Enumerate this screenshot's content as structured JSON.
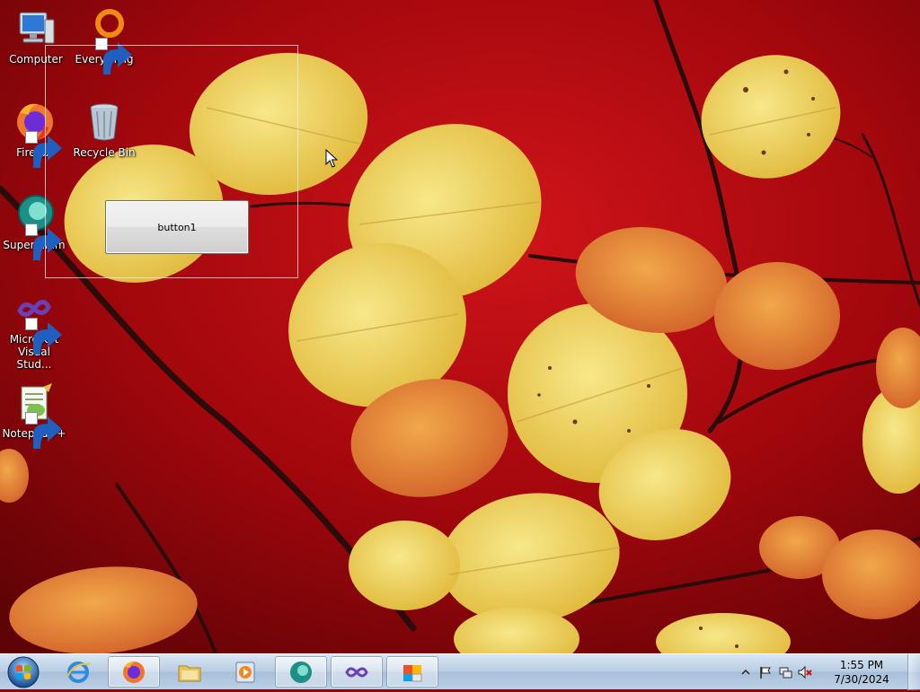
{
  "desktop": {
    "icons": [
      {
        "label": "Computer",
        "icon": "computer-icon"
      },
      {
        "label": "Everything",
        "icon": "everything-icon"
      },
      {
        "label": "Firefox",
        "icon": "firefox-icon"
      },
      {
        "label": "Recycle Bin",
        "icon": "recycle-bin-icon"
      },
      {
        "label": "Supermium",
        "icon": "supermium-icon"
      },
      {
        "label": "Microsoft Visual Stud...",
        "icon": "visual-studio-icon"
      },
      {
        "label": "Notepad++",
        "icon": "notepad-plus-plus-icon"
      }
    ]
  },
  "form": {
    "button_label": "button1"
  },
  "taskbar": {
    "start": "start-orb-icon",
    "pinned": [
      {
        "icon": "internet-explorer-icon",
        "active": false
      },
      {
        "icon": "firefox-icon",
        "active": true
      },
      {
        "icon": "file-explorer-icon",
        "active": false
      },
      {
        "icon": "media-player-icon",
        "active": false
      },
      {
        "icon": "supermium-icon",
        "active": true
      },
      {
        "icon": "visual-studio-icon",
        "active": true
      },
      {
        "icon": "form-app-icon",
        "active": true
      }
    ],
    "tray": {
      "icons": [
        "show-hidden-icons-chevron",
        "action-center-flag-icon",
        "network-icon",
        "volume-muted-icon"
      ],
      "time": "1:55 PM",
      "date": "7/30/2024"
    }
  },
  "colors": {
    "wallpaper_red": "#b3080d",
    "leaf_yellow": "#f0d660",
    "leaf_orange": "#e8893a",
    "taskbar": "#b9cde3"
  }
}
